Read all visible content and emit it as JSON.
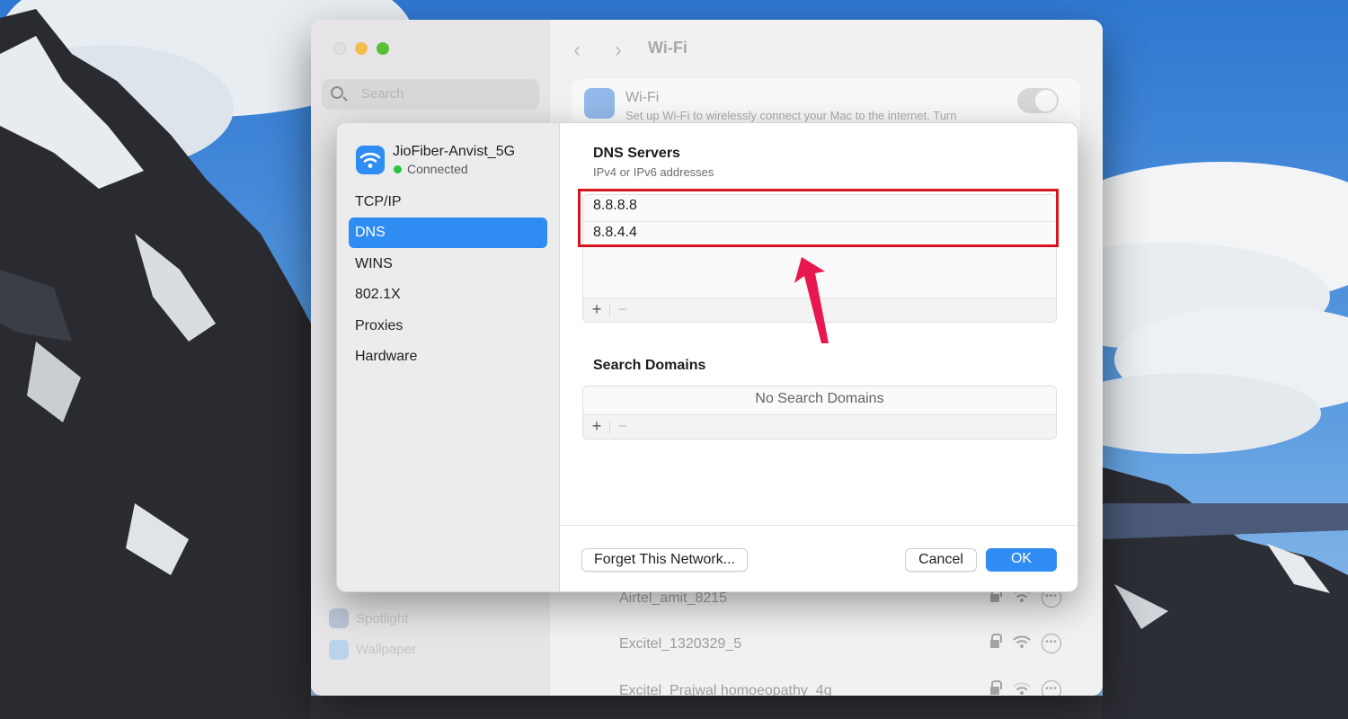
{
  "settings_window": {
    "search_placeholder": "Search",
    "title": "Wi-Fi",
    "dim_sidebar_items": [
      "Spotlight",
      "Wallpaper"
    ],
    "wifi_card": {
      "title": "Wi-Fi",
      "description": "Set up Wi-Fi to wirelessly connect your Mac to the internet. Turn"
    },
    "networks": [
      {
        "name": "Airtel_amit_8215"
      },
      {
        "name": "Excitel_1320329_5"
      },
      {
        "name": "Excitel_Prajwal homoeopathy_4g"
      }
    ]
  },
  "dns_sheet": {
    "network_name": "JioFiber-Anvist_5G",
    "status": "Connected",
    "tabs": [
      {
        "label": "TCP/IP"
      },
      {
        "label": "DNS"
      },
      {
        "label": "WINS"
      },
      {
        "label": "802.1X"
      },
      {
        "label": "Proxies"
      },
      {
        "label": "Hardware"
      }
    ],
    "active_tab": "DNS",
    "dns_servers": {
      "title": "DNS Servers",
      "subtitle": "IPv4 or IPv6 addresses",
      "entries": [
        "8.8.8.8",
        "8.8.4.4"
      ]
    },
    "search_domains": {
      "title": "Search Domains",
      "empty_text": "No Search Domains"
    },
    "list_buttons": {
      "add": "+",
      "remove": "−"
    },
    "buttons": {
      "forget": "Forget This Network...",
      "cancel": "Cancel",
      "ok": "OK"
    }
  },
  "colors": {
    "accent": "#2f8cf2",
    "highlight": "#d8151c",
    "arrow": "#e8174f",
    "connected": "#2bc43e"
  }
}
